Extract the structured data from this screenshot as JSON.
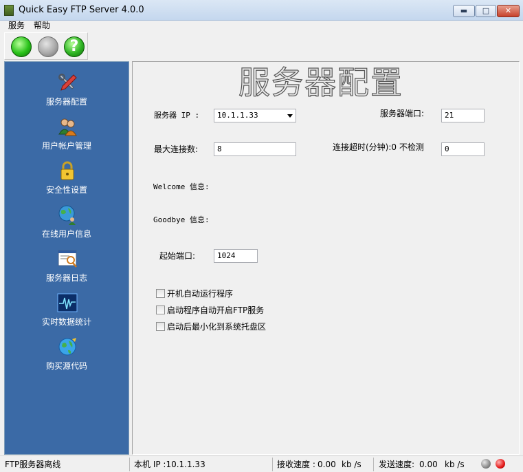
{
  "window": {
    "title": "Quick Easy FTP Server 4.0.0",
    "controls": {
      "minimize": "▬",
      "maximize": "□",
      "close": "✕"
    }
  },
  "menu": {
    "items": [
      {
        "label": "服务"
      },
      {
        "label": "帮助"
      }
    ]
  },
  "toolbar": {
    "buttons": [
      {
        "name": "start-server",
        "icon": "green-circle-icon"
      },
      {
        "name": "stop-server",
        "icon": "grey-circle-icon"
      },
      {
        "name": "help",
        "icon": "help-icon",
        "glyph": "?"
      }
    ]
  },
  "sidebar": {
    "items": [
      {
        "label": "服务器配置",
        "icon": "tools-icon"
      },
      {
        "label": "用户帐户管理",
        "icon": "users-icon"
      },
      {
        "label": "安全性设置",
        "icon": "lock-icon"
      },
      {
        "label": "在线用户信息",
        "icon": "globe-users-icon"
      },
      {
        "label": "服务器日志",
        "icon": "log-icon"
      },
      {
        "label": "实时数据统计",
        "icon": "stats-icon"
      },
      {
        "label": "购买源代码",
        "icon": "globe-icon"
      }
    ]
  },
  "main": {
    "heading": "服务器配置",
    "server_ip_label": "服务器 IP :",
    "server_ip_value": "10.1.1.33",
    "server_port_label": "服务器端口:",
    "server_port_value": "21",
    "max_conn_label": "最大连接数:",
    "max_conn_value": "8",
    "timeout_label": "连接超时(分钟):0 不检测",
    "timeout_value": "0",
    "welcome_label": "Welcome 信息:",
    "goodbye_label": "Goodbye 信息:",
    "start_port_label": "起始端口:",
    "start_port_value": "1024",
    "checkboxes": [
      {
        "label": "开机自动运行程序",
        "checked": false
      },
      {
        "label": "启动程序自动开启FTP服务",
        "checked": false
      },
      {
        "label": "启动后最小化到系统托盘区",
        "checked": false
      }
    ]
  },
  "status": {
    "server_state": "FTP服务器离线",
    "local_ip": "本机 IP :10.1.1.33",
    "recv_speed_label": "接收速度 :",
    "recv_speed_value": "0.00",
    "recv_unit": "kb /s",
    "send_speed_label": "发送速度:",
    "send_speed_value": "0.00",
    "send_unit": "kb /s",
    "indicators": [
      {
        "name": "grey",
        "color": "#8a8a8a"
      },
      {
        "name": "red",
        "color": "#e41a1a"
      }
    ]
  }
}
